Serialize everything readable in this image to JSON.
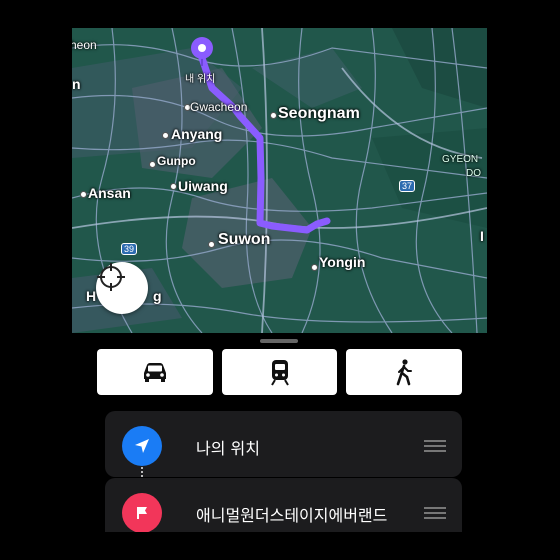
{
  "map": {
    "labels": {
      "heon": "heon",
      "n": "n",
      "my_location": "내 위치",
      "gwacheon": "Gwacheon",
      "seongnam": "Seongnam",
      "anyang": "Anyang",
      "gunpo": "Gunpo",
      "uiwang": "Uiwang",
      "ansan": "Ansan",
      "suwon": "Suwon",
      "yongin": "Yongin",
      "hwaseong_partial": "H",
      "hwaseong_tail": "g",
      "gyeon": "GYEON",
      "do": "DO",
      "road_37": "37",
      "road_39": "39",
      "edge_i": "I"
    },
    "route_color": "#8a5cff",
    "pin_color": "#8a5cff"
  },
  "colors": {
    "map_green": "#21574b",
    "stop_origin": "#1a7cf5",
    "stop_dest": "#f2365a"
  },
  "transport_modes": [
    {
      "name": "car",
      "icon": "car-icon"
    },
    {
      "name": "transit",
      "icon": "train-icon"
    },
    {
      "name": "walk",
      "icon": "walking-icon"
    }
  ],
  "stops": {
    "origin": {
      "label": "나의 위치",
      "icon": "navigation-arrow-icon"
    },
    "destination": {
      "label": "애니멀원더스테이지에버랜드",
      "icon": "flag-icon"
    }
  }
}
